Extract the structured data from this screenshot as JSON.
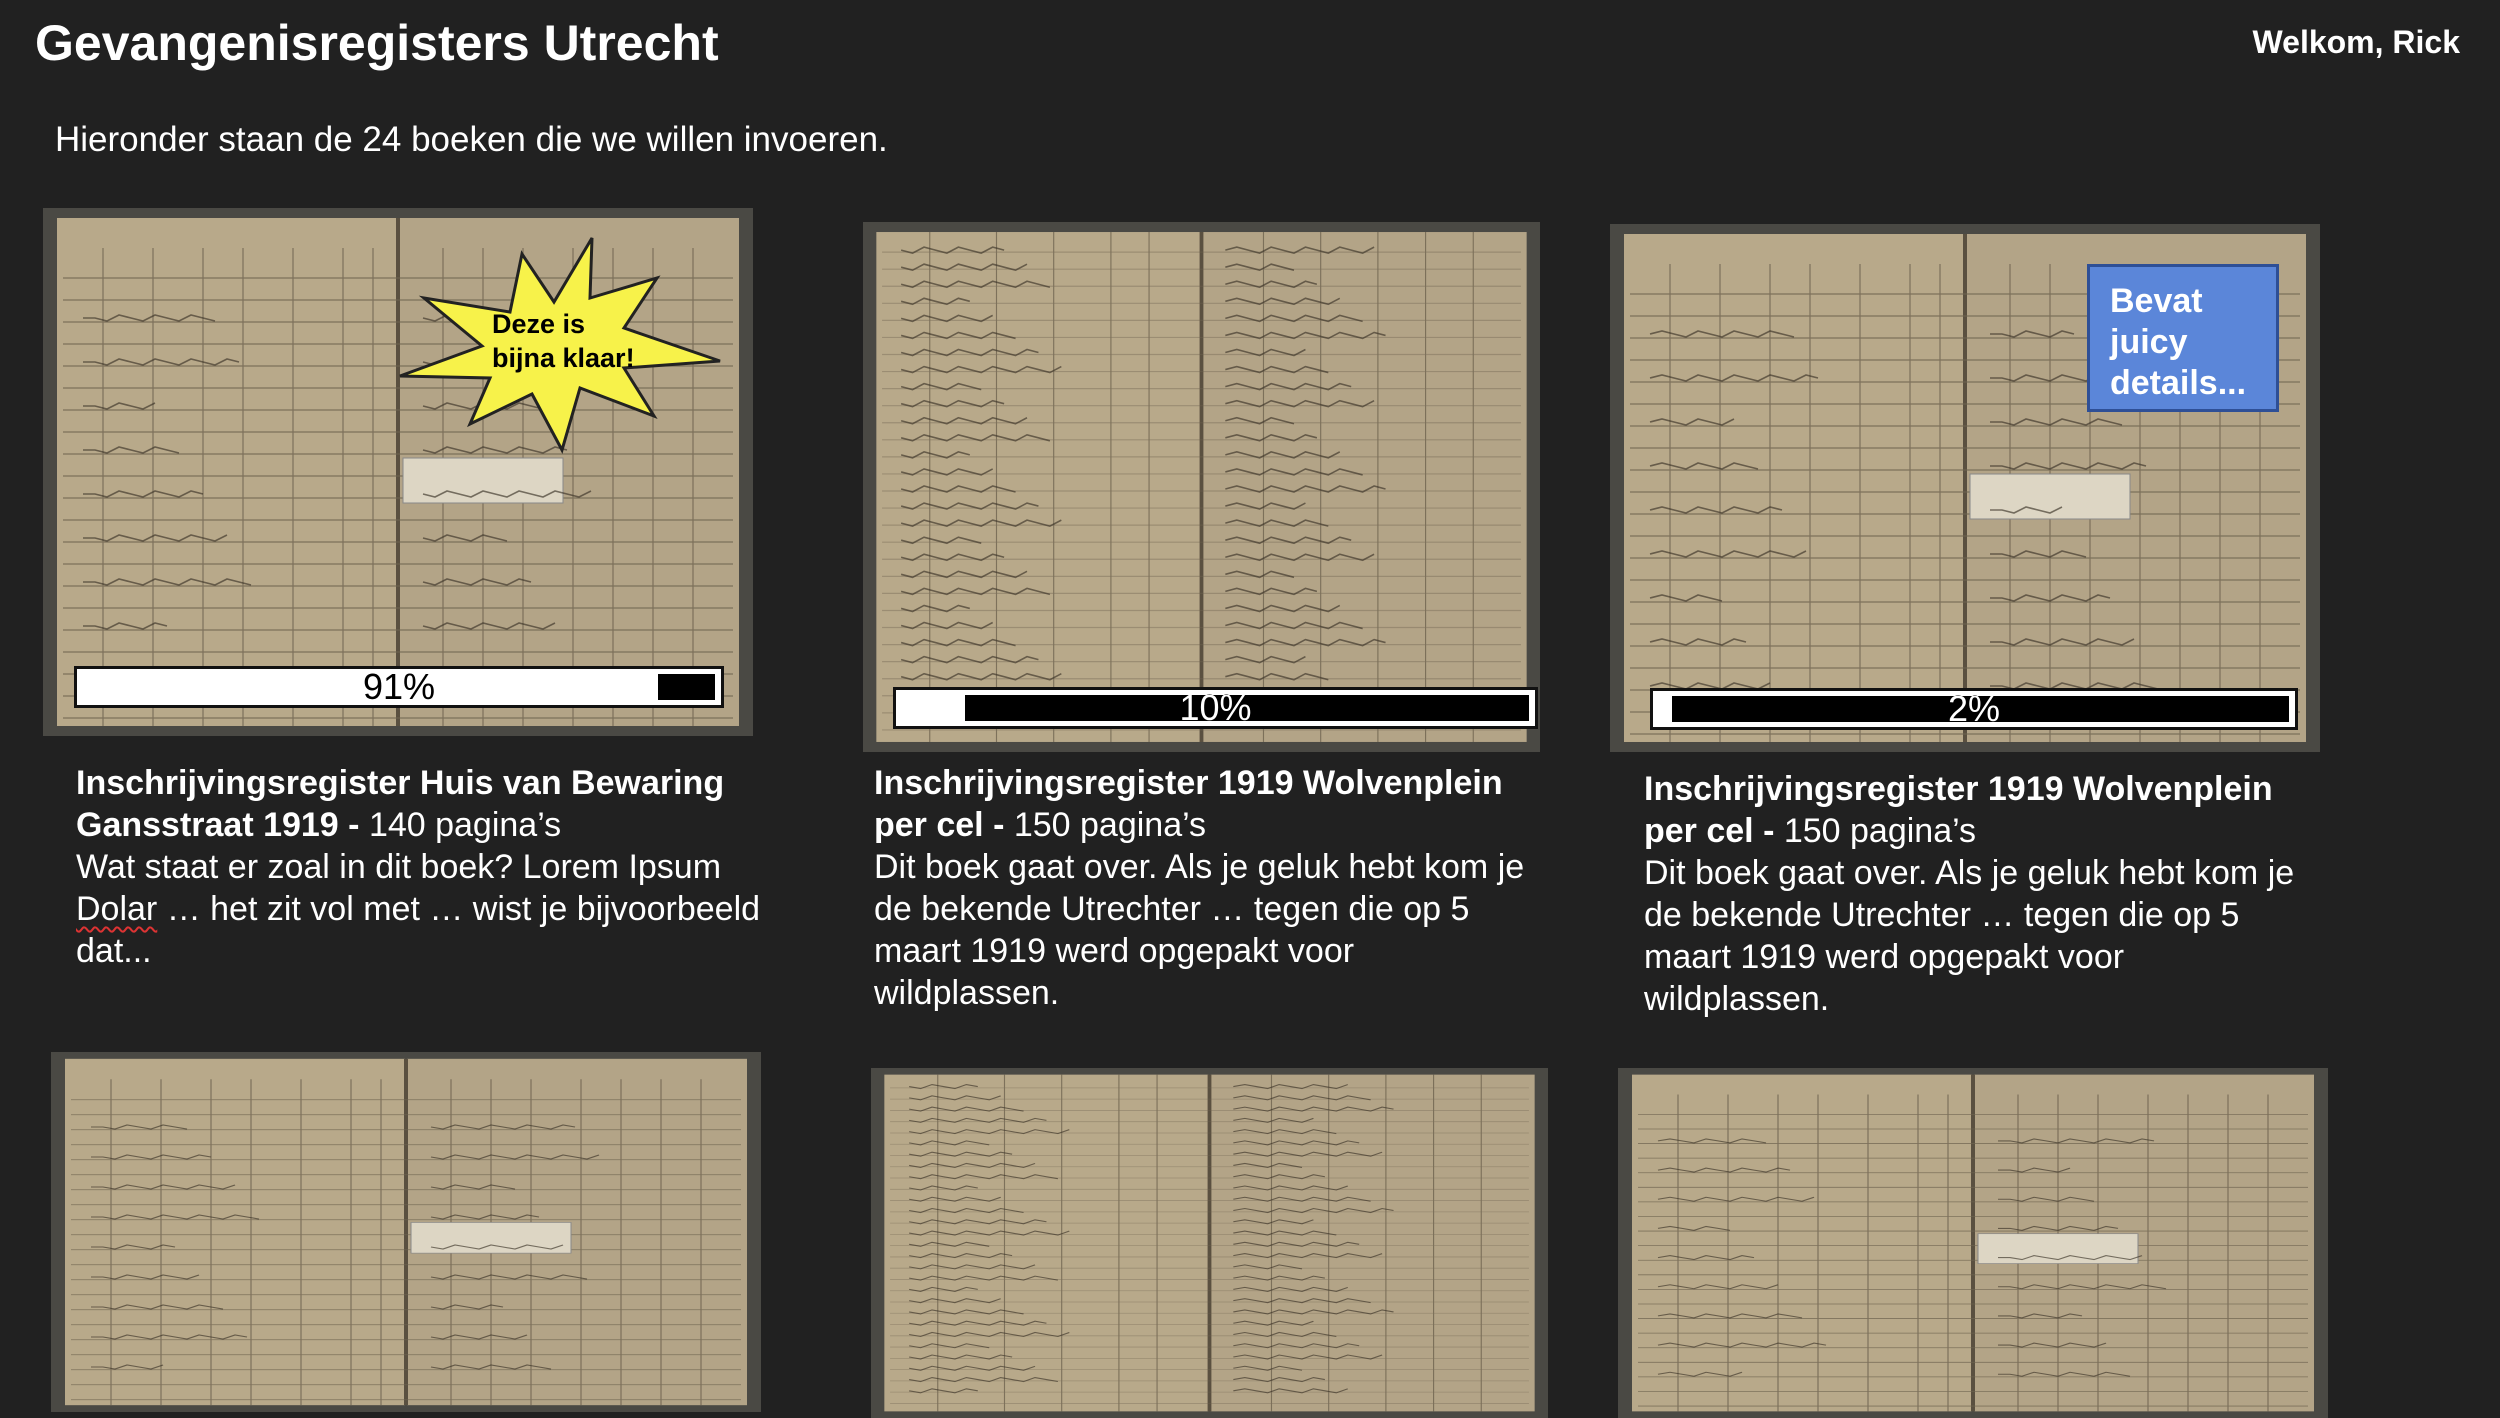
{
  "header": {
    "title": "Gevangenisregisters Utrecht",
    "welcome": "Welkom, Rick"
  },
  "intro": "Hieronder staan de 24 boeken die we willen invoeren.",
  "books": [
    {
      "title": "Inschrijvingsregister Huis van Bewaring Gansstraat 1919 - ",
      "pages": "140 pagina’s",
      "desc_a": "Wat staat er zoal in dit boek? Lorem Ipsum ",
      "desc_misspelled": "Dolar",
      "desc_b": " … het zit vol met … wist je bijvoorbeeld dat...",
      "progress_label": "91%",
      "progress": 0.91,
      "badge": "Deze is bijna klaar!"
    },
    {
      "title": "Inschrijvingsregister 1919 Wolvenplein per cel - ",
      "pages": "150 pagina’s",
      "desc": "Dit boek gaat over. Als je geluk hebt kom je de bekende Utrechter … tegen die op 5 maart 1919 werd opgepakt voor wildplassen.",
      "progress_label": "10%",
      "progress": 0.1
    },
    {
      "title": "Inschrijvingsregister 1919 Wolvenplein per cel - ",
      "pages": "150 pagina’s",
      "desc": "Dit boek gaat over. Als je geluk hebt kom je de bekende Utrechter … tegen die op 5 maart 1919 werd opgepakt voor wildplassen.",
      "progress_label": "2%",
      "progress": 0.02,
      "callout": "Bevat juicy details..."
    }
  ],
  "colors": {
    "background": "#212121",
    "paper": "#b8a98a",
    "callout": "#5b86d9",
    "burst": "#f7f24a"
  }
}
